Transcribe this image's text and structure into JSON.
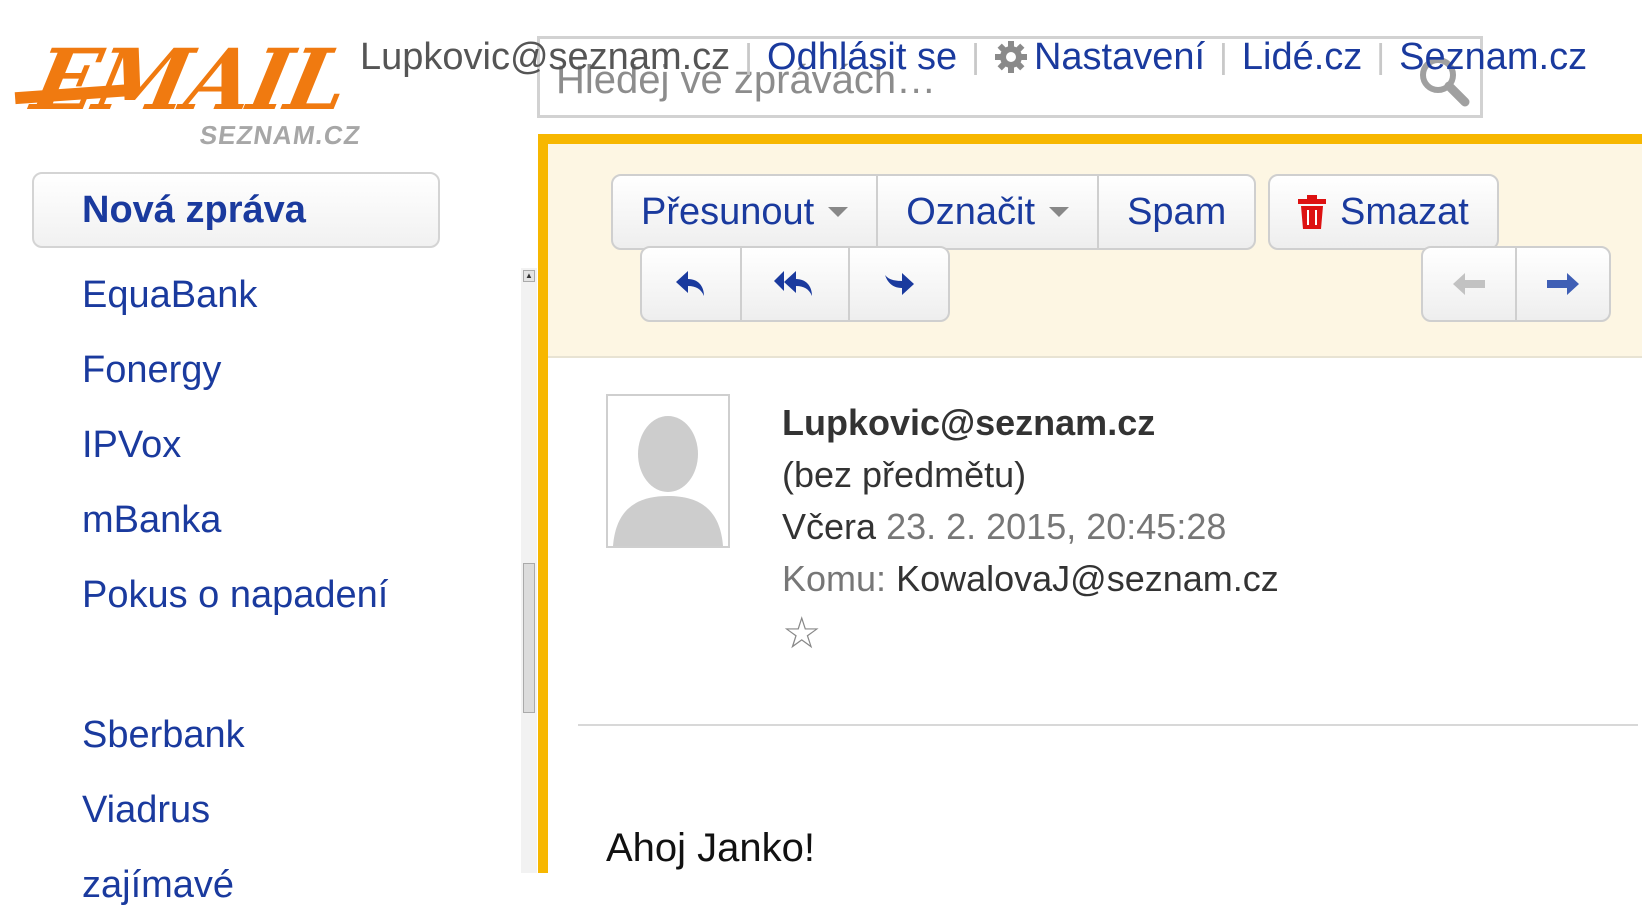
{
  "logo": {
    "word": "EMAIL",
    "sub": "SEZNAM.CZ"
  },
  "search": {
    "placeholder": "Hledej ve zprávách…"
  },
  "header": {
    "user": "Lupkovic@seznam.cz",
    "logout": "Odhlásit se",
    "settings": "Nastavení",
    "lide": "Lidé.cz",
    "seznam": "Seznam.cz"
  },
  "sidebar": {
    "new_message": "Nová zpráva",
    "folders": [
      "EquaBank",
      "Fonergy",
      "IPVox",
      "mBanka",
      "Pokus o napadení",
      "Sberbank",
      "Viadrus",
      "zajímavé"
    ]
  },
  "toolbar": {
    "move": "Přesunout",
    "mark": "Označit",
    "spam": "Spam",
    "delete": "Smazat"
  },
  "message": {
    "sender": "Lupkovic@seznam.cz",
    "subject": "(bez předmětu)",
    "date_label": "Včera",
    "date_value": "23. 2. 2015, 20:45:28",
    "to_label": "Komu:",
    "to_value": "KowalovaJ@seznam.cz",
    "body": "Ahoj  Janko!"
  },
  "colors": {
    "accent": "#f7b700",
    "link": "#1a3a9e",
    "logo": "#f07a10"
  }
}
